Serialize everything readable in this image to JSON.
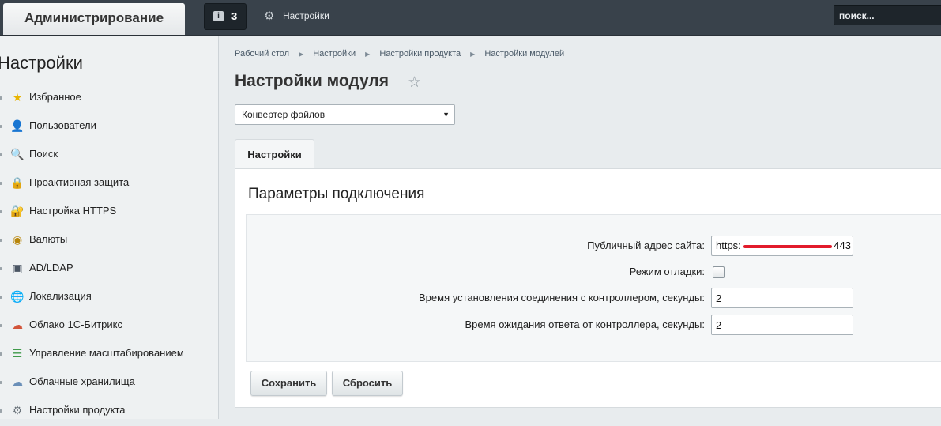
{
  "topbar": {
    "admin_label": "Администрирование",
    "notifications_count": "3",
    "settings_label": "Настройки",
    "search_value": "поиск..."
  },
  "sidebar": {
    "title": "Настройки",
    "items": [
      {
        "label": "Избранное",
        "icon": "star-icon"
      },
      {
        "label": "Пользователи",
        "icon": "user-icon"
      },
      {
        "label": "Поиск",
        "icon": "magnifier-icon"
      },
      {
        "label": "Проактивная защита",
        "icon": "lock-icon"
      },
      {
        "label": "Настройка HTTPS",
        "icon": "https-lock-icon"
      },
      {
        "label": "Валюты",
        "icon": "coin-icon"
      },
      {
        "label": "AD/LDAP",
        "icon": "ldap-icon"
      },
      {
        "label": "Локализация",
        "icon": "globe-icon"
      },
      {
        "label": "Облако 1С-Битрикс",
        "icon": "cloud-icon"
      },
      {
        "label": "Управление масштабированием",
        "icon": "server-icon"
      },
      {
        "label": "Облачные хранилища",
        "icon": "storage-icon"
      },
      {
        "label": "Настройки продукта",
        "icon": "gear-icon"
      }
    ]
  },
  "breadcrumb": [
    "Рабочий стол",
    "Настройки",
    "Настройки продукта",
    "Настройки модулей"
  ],
  "page": {
    "title": "Настройки модуля",
    "module_select_value": "Конвертер файлов",
    "tab_label": "Настройки",
    "section_title": "Параметры подключения"
  },
  "form": {
    "public_url_label": "Публичный адрес сайта:",
    "public_url_value_start": "https:",
    "public_url_value_end": "443",
    "debug_label": "Режим отладки:",
    "debug_checked": false,
    "connect_timeout_label": "Время установления соединения с контроллером, секунды:",
    "connect_timeout_value": "2",
    "response_timeout_label": "Время ожидания ответа от контроллера, секунды:",
    "response_timeout_value": "2"
  },
  "buttons": {
    "save": "Сохранить",
    "reset": "Сбросить"
  },
  "colors": {
    "topbar": "#39424b",
    "sidebar": "#eef1f2",
    "background": "#e8ecee",
    "redaction": "#e21b2b"
  }
}
